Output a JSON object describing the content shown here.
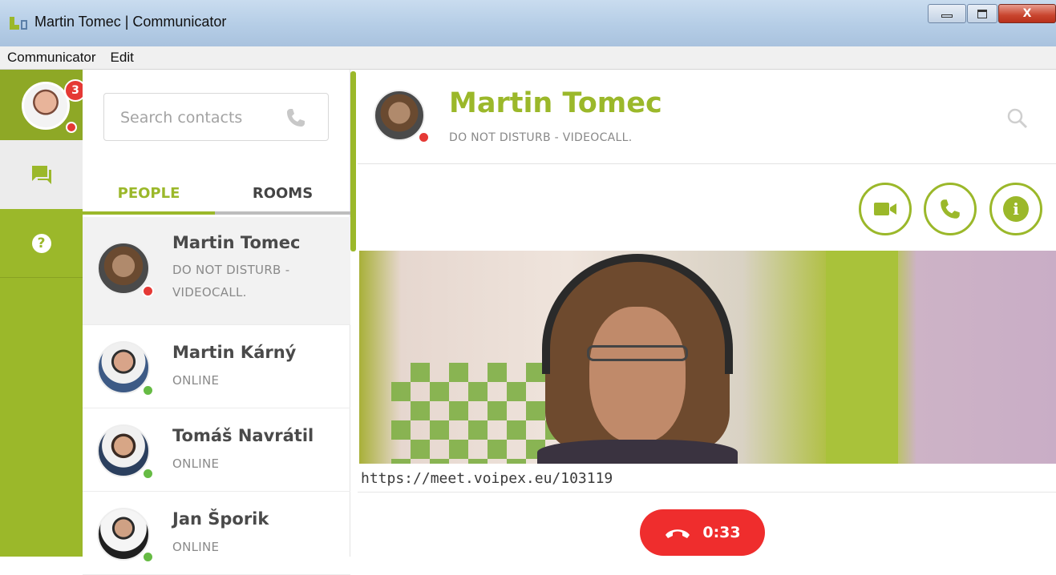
{
  "window": {
    "title": "Martin Tomec | Communicator",
    "controls": [
      "minimize",
      "maximize",
      "close"
    ],
    "close_glyph": "X"
  },
  "menu": {
    "items": [
      "Communicator",
      "Edit"
    ]
  },
  "rail": {
    "notification_count": "3",
    "self_status_color": "#e53935",
    "items": [
      {
        "icon": "chat-icon",
        "active": true
      },
      {
        "icon": "help-icon",
        "glyph": "?"
      }
    ]
  },
  "contacts_panel": {
    "search": {
      "placeholder": "Search contacts"
    },
    "tabs": [
      {
        "label": "PEOPLE",
        "active": true
      },
      {
        "label": "ROOMS",
        "active": false
      }
    ],
    "contacts": [
      {
        "name": "Martin Tomec",
        "status": "DO NOT DISTURB - VIDEOCALL.",
        "status_color": "#e53935",
        "selected": true
      },
      {
        "name": "Martin Kárný",
        "status": "ONLINE",
        "status_color": "#66bb44"
      },
      {
        "name": "Tomáš Navrátil",
        "status": "ONLINE",
        "status_color": "#66bb44"
      },
      {
        "name": "Jan Šporik",
        "status": "ONLINE",
        "status_color": "#66bb44"
      }
    ]
  },
  "conversation": {
    "name": "Martin Tomec",
    "status": "DO NOT DISTURB - VIDEOCALL.",
    "actions": [
      "video-icon",
      "phone-icon",
      "info-icon"
    ],
    "info_glyph": "i",
    "meeting_url": "https://meet.voipex.eu/103119",
    "call_timer": "0:33"
  },
  "colors": {
    "accent": "#9bb82a",
    "hangup": "#ef2d2d",
    "online": "#66bb44",
    "dnd": "#e53935"
  }
}
